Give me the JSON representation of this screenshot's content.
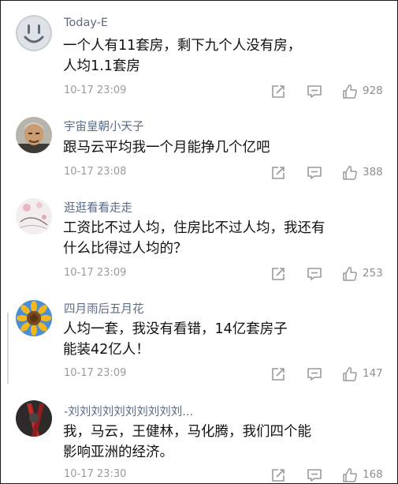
{
  "comments": [
    {
      "username": "Today-E",
      "lines": [
        "一个人有11套房，剩下九个人没有房，",
        "人均1.1套房"
      ],
      "timestamp": "10-17 23:09",
      "likes": "928",
      "avatar_icon": "grey-smiley-face-avatar"
    },
    {
      "username": "宇宙皇朝小天子",
      "lines": [
        "跟马云平均我一个月能挣几个亿吧"
      ],
      "timestamp": "10-17 23:08",
      "likes": "388",
      "avatar_icon": "man-portrait-avatar"
    },
    {
      "username": "逛逛看看走走",
      "lines": [
        "工资比不过人均，住房比不过人均，我还有",
        "什么比得过人均的？"
      ],
      "timestamp": "10-17 23:09",
      "likes": "253",
      "avatar_icon": "pink-floral-avatar"
    },
    {
      "username": "四月雨后五月花",
      "lines": [
        "人均一套，我没有看错，14亿套房子",
        "能装42亿人！"
      ],
      "timestamp": "10-17 23:09",
      "likes": "147",
      "avatar_icon": "sunflower-avatar"
    },
    {
      "username": "-刘刘刘刘刘刘刘刘刘刘...",
      "lines": [
        "我，马云，王健林，马化腾，我们四个能",
        "影响亚洲的经济。"
      ],
      "timestamp": "10-17 23:30",
      "likes": "168",
      "avatar_icon": "red-dark-pattern-avatar"
    }
  ],
  "icons": {
    "share": "share-icon",
    "reply": "comment-icon",
    "like": "thumbs-up-icon"
  },
  "colors": {
    "username": "#5c6b84",
    "text": "#111111",
    "meta": "#9a9a9a"
  }
}
